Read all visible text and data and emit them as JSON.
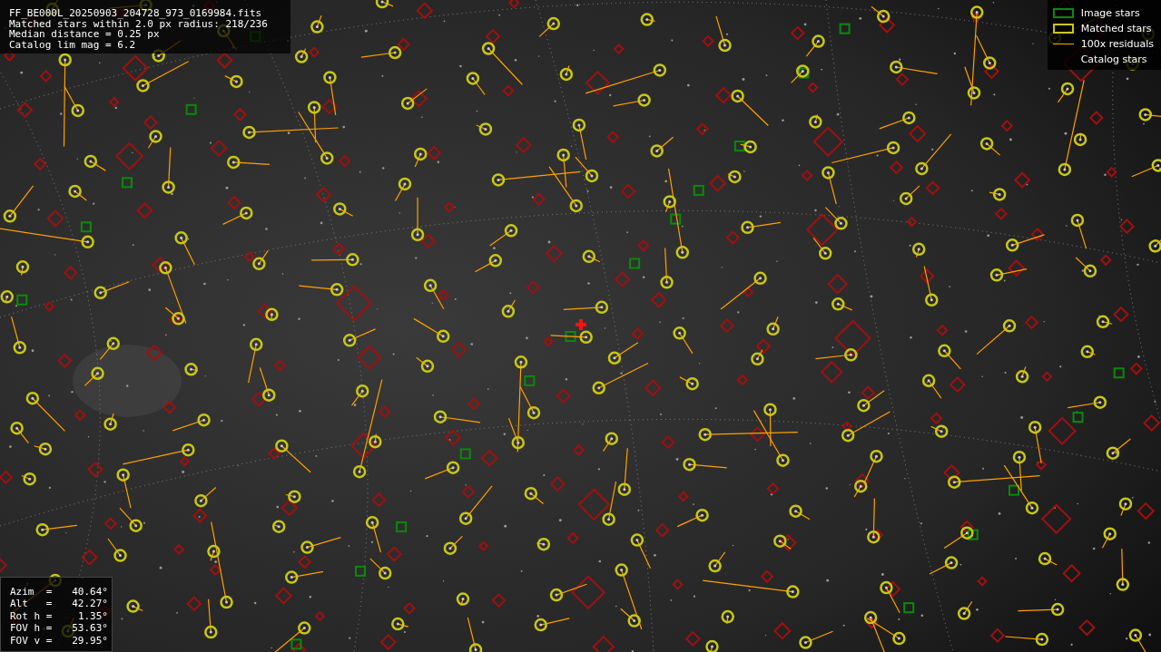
{
  "info_lines": [
    "FF_BE000L_20250903_204728_973_0169984.fits",
    "Matched stars within 2.0 px radius: 218/236",
    "Median distance = 0.25 px",
    "Catalog lim mag = 6.2"
  ],
  "legend": [
    {
      "label": "Image stars",
      "kind": "box",
      "color": "#0a8a0a"
    },
    {
      "label": "Matched stars",
      "kind": "box",
      "color": "#c8c814"
    },
    {
      "label": "100x residuals",
      "kind": "line",
      "color": "#ffa000"
    },
    {
      "label": "Catalog stars",
      "kind": "none"
    }
  ],
  "pointing": [
    {
      "label": "Azim  =",
      "value": "40.64°"
    },
    {
      "label": "Alt   =",
      "value": "42.27°"
    },
    {
      "label": "Rot h =",
      "value": "1.35°"
    },
    {
      "label": "FOV h =",
      "value": "53.63°"
    },
    {
      "label": "FOV v =",
      "value": "29.95°"
    }
  ]
}
